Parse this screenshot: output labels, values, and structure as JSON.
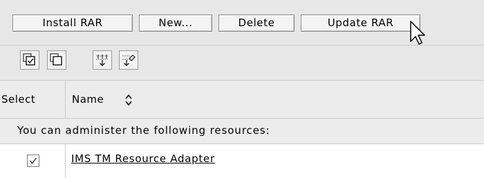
{
  "toolbar": {
    "buttons": [
      {
        "label": "Install RAR"
      },
      {
        "label": "New..."
      },
      {
        "label": "Delete"
      },
      {
        "label": "Update RAR"
      }
    ]
  },
  "icon_toolbar": {
    "icons": [
      "select-all-icon",
      "deselect-all-icon",
      "expand-filter-icon",
      "clear-filter-icon"
    ]
  },
  "table": {
    "columns": [
      {
        "label": "Select"
      },
      {
        "label": "Name"
      }
    ],
    "message": "You can administer the following resources:",
    "rows": [
      {
        "selected": true,
        "name": "IMS TM Resource Adapter"
      }
    ]
  }
}
